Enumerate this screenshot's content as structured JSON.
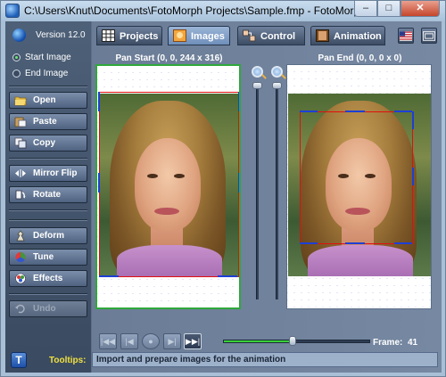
{
  "window": {
    "title": "C:\\Users\\Knut\\Documents\\FotoMorph Projects\\Sample.fmp - FotoMorph",
    "minimize": "–",
    "maximize": "□",
    "close": "✕"
  },
  "sidebar": {
    "version": "Version 12.0",
    "start_image": "Start Image",
    "end_image": "End Image",
    "selected_image": "start",
    "buttons": {
      "open": "Open",
      "paste": "Paste",
      "copy": "Copy",
      "mirror_flip": "Mirror Flip",
      "rotate": "Rotate",
      "deform": "Deform",
      "tune": "Tune",
      "effects": "Effects",
      "undo": "Undo"
    },
    "icons": [
      "folder-open-icon",
      "paste-icon",
      "copy-icon",
      "mirror-flip-icon",
      "rotate-icon",
      "deform-icon",
      "tune-icon",
      "effects-icon",
      "undo-icon"
    ]
  },
  "tabs": [
    {
      "label": "Projects",
      "icon": "projects-grid-icon",
      "active": false
    },
    {
      "label": "Images",
      "icon": "images-icon",
      "active": true
    },
    {
      "label": "Control",
      "icon": "control-icon",
      "active": false
    },
    {
      "label": "Animation",
      "icon": "animation-film-icon",
      "active": false
    }
  ],
  "panels": {
    "start_label": "Pan Start (0, 0, 244 x 316)",
    "end_label": "Pan End (0, 0, 0 x 0)"
  },
  "playback": {
    "first": "|◀◀",
    "prev": "|◀",
    "stop": "●",
    "next": "▶|",
    "last": "▶▶|",
    "frame_label": "Frame:",
    "frame_value": "41",
    "position_fraction": 0.47
  },
  "tooltips": {
    "button": "T",
    "label": "Tooltips:",
    "text": "Import and prepare images for the animation"
  },
  "colors": {
    "selected_panel_border": "#2fa83a",
    "selection_red": "#e01010",
    "selection_blue": "#1d3fd6",
    "tooltip_label": "#f0e040"
  }
}
